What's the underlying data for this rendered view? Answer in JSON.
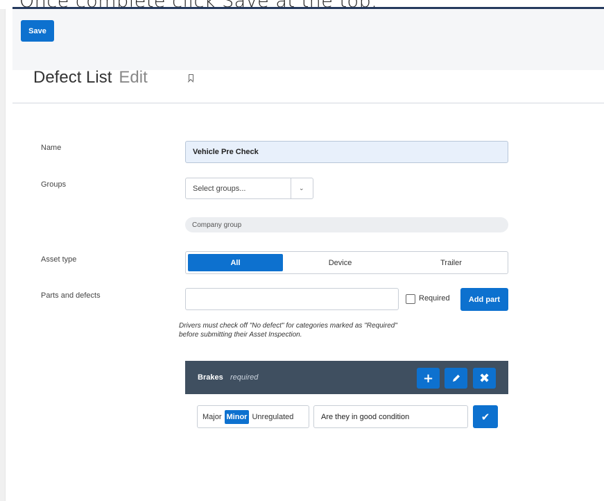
{
  "caption": "Once complete click Save at the top.",
  "toolbar": {
    "save_label": "Save"
  },
  "header": {
    "title": "Defect List",
    "subtitle": "Edit",
    "bookmark_icon": "bookmark-icon"
  },
  "form": {
    "name": {
      "label": "Name",
      "value": "Vehicle Pre Check"
    },
    "groups": {
      "label": "Groups",
      "placeholder": "Select groups...",
      "selected_chip": "Company group"
    },
    "asset_type": {
      "label": "Asset type",
      "options": [
        "All",
        "Device",
        "Trailer"
      ],
      "selected": "All"
    },
    "parts": {
      "label": "Parts and defects",
      "input_value": "",
      "required_label": "Required",
      "required_checked": false,
      "add_label": "Add part",
      "note_line1": "Drivers must check off \"No defect\" for categories marked as \"Required\"",
      "note_line2": "before submitting their Asset Inspection."
    }
  },
  "category": {
    "name": "Brakes",
    "required_text": "required",
    "actions": [
      "add",
      "edit",
      "delete"
    ]
  },
  "defect": {
    "severities": [
      "Major",
      "Minor",
      "Unregulated"
    ],
    "selected_severity": "Minor",
    "description": "Are they in good condition"
  },
  "colors": {
    "accent": "#0d71cf",
    "category_bar": "#3f4f60",
    "name_field_bg": "#e8f0fb"
  }
}
